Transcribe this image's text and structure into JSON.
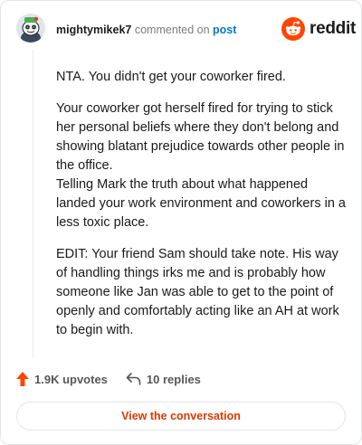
{
  "header": {
    "username": "mightymikek7",
    "commented_on": "commented on",
    "post_link": "post",
    "brand": "reddit"
  },
  "comment": {
    "paragraph_1": "NTA. You didn't get your coworker fired.",
    "paragraph_2": "Your coworker got herself fired for trying to stick her personal beliefs where they don't belong and showing blatant prejudice towards other people in the office.",
    "paragraph_3": "Telling Mark the truth about what happened landed your work environment and coworkers in a less toxic place.",
    "paragraph_4": "EDIT: Your friend Sam should take note. His way of handling things irks me and is probably how someone like Jan was able to get to the point of openly and comfortably acting like an AH at work to begin with."
  },
  "actions": {
    "upvotes": "1.9K upvotes",
    "replies": "10 replies"
  },
  "footer": {
    "view_button": "View the conversation"
  },
  "colors": {
    "brand_orange": "#ff4500",
    "link_blue": "#0079d3",
    "button_text": "#d93a00"
  },
  "icons": {
    "avatar": "snoo-avatar",
    "brand": "reddit-logo-icon",
    "upvote": "upvote-arrow-icon",
    "reply": "reply-arrow-icon"
  }
}
